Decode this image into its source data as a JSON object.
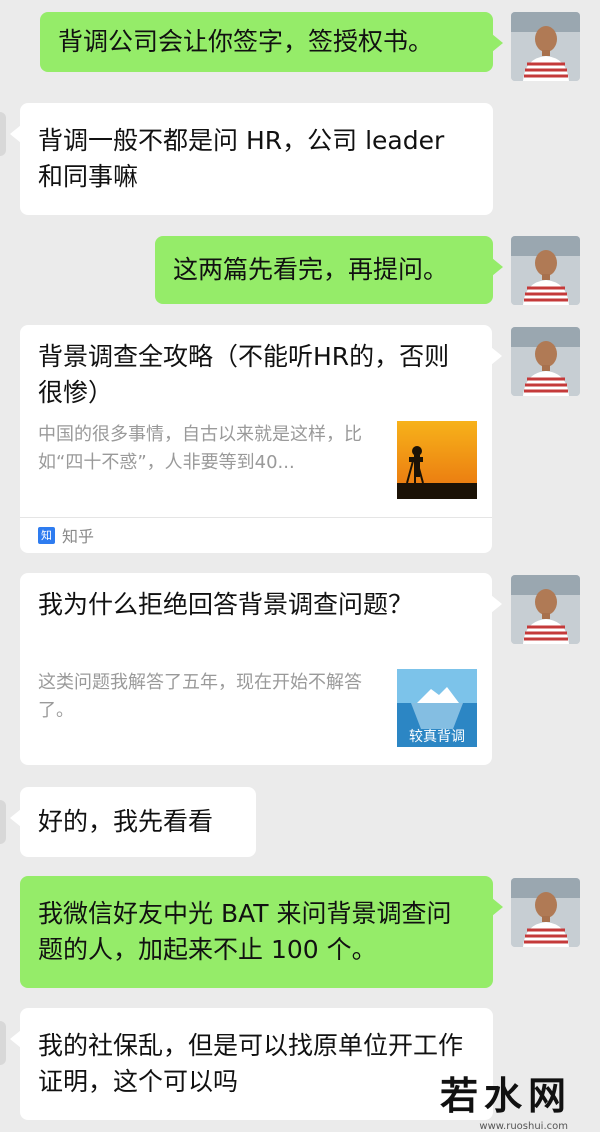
{
  "messages": [
    {
      "side": "me",
      "text": "背调公司会让你签字，签授权书。"
    },
    {
      "side": "them",
      "text": "背调一般不都是问 HR，公司 leader 和同事嘛"
    },
    {
      "side": "me",
      "text": "这两篇先看完，再提问。"
    },
    {
      "side": "me",
      "type": "link-card",
      "title": "背景调查全攻略（不能听HR的，否则很惨）",
      "desc": "中国的很多事情，自古以来就是这样，比如“四十不惑”，人非要等到40...",
      "source": "知乎",
      "source_icon": "知"
    },
    {
      "side": "me",
      "type": "link-card",
      "title": "我为什么拒绝回答背景调查问题？",
      "desc": "这类问题我解答了五年，现在开始不解答了。",
      "thumb_caption": "较真背调"
    },
    {
      "side": "them",
      "text": "好的，我先看看"
    },
    {
      "side": "me",
      "text": "我微信好友中光 BAT 来问背景调查问题的人，加起来不止 100 个。"
    },
    {
      "side": "them",
      "text": "我的社保乱，但是可以找原单位开工作证明，这个可以吗"
    }
  ],
  "watermark": {
    "text": "若水网",
    "sub": "www.ruoshui.com"
  },
  "colors": {
    "self_bubble": "#95ec69",
    "other_bubble": "#ffffff",
    "background": "#ebebeb"
  }
}
